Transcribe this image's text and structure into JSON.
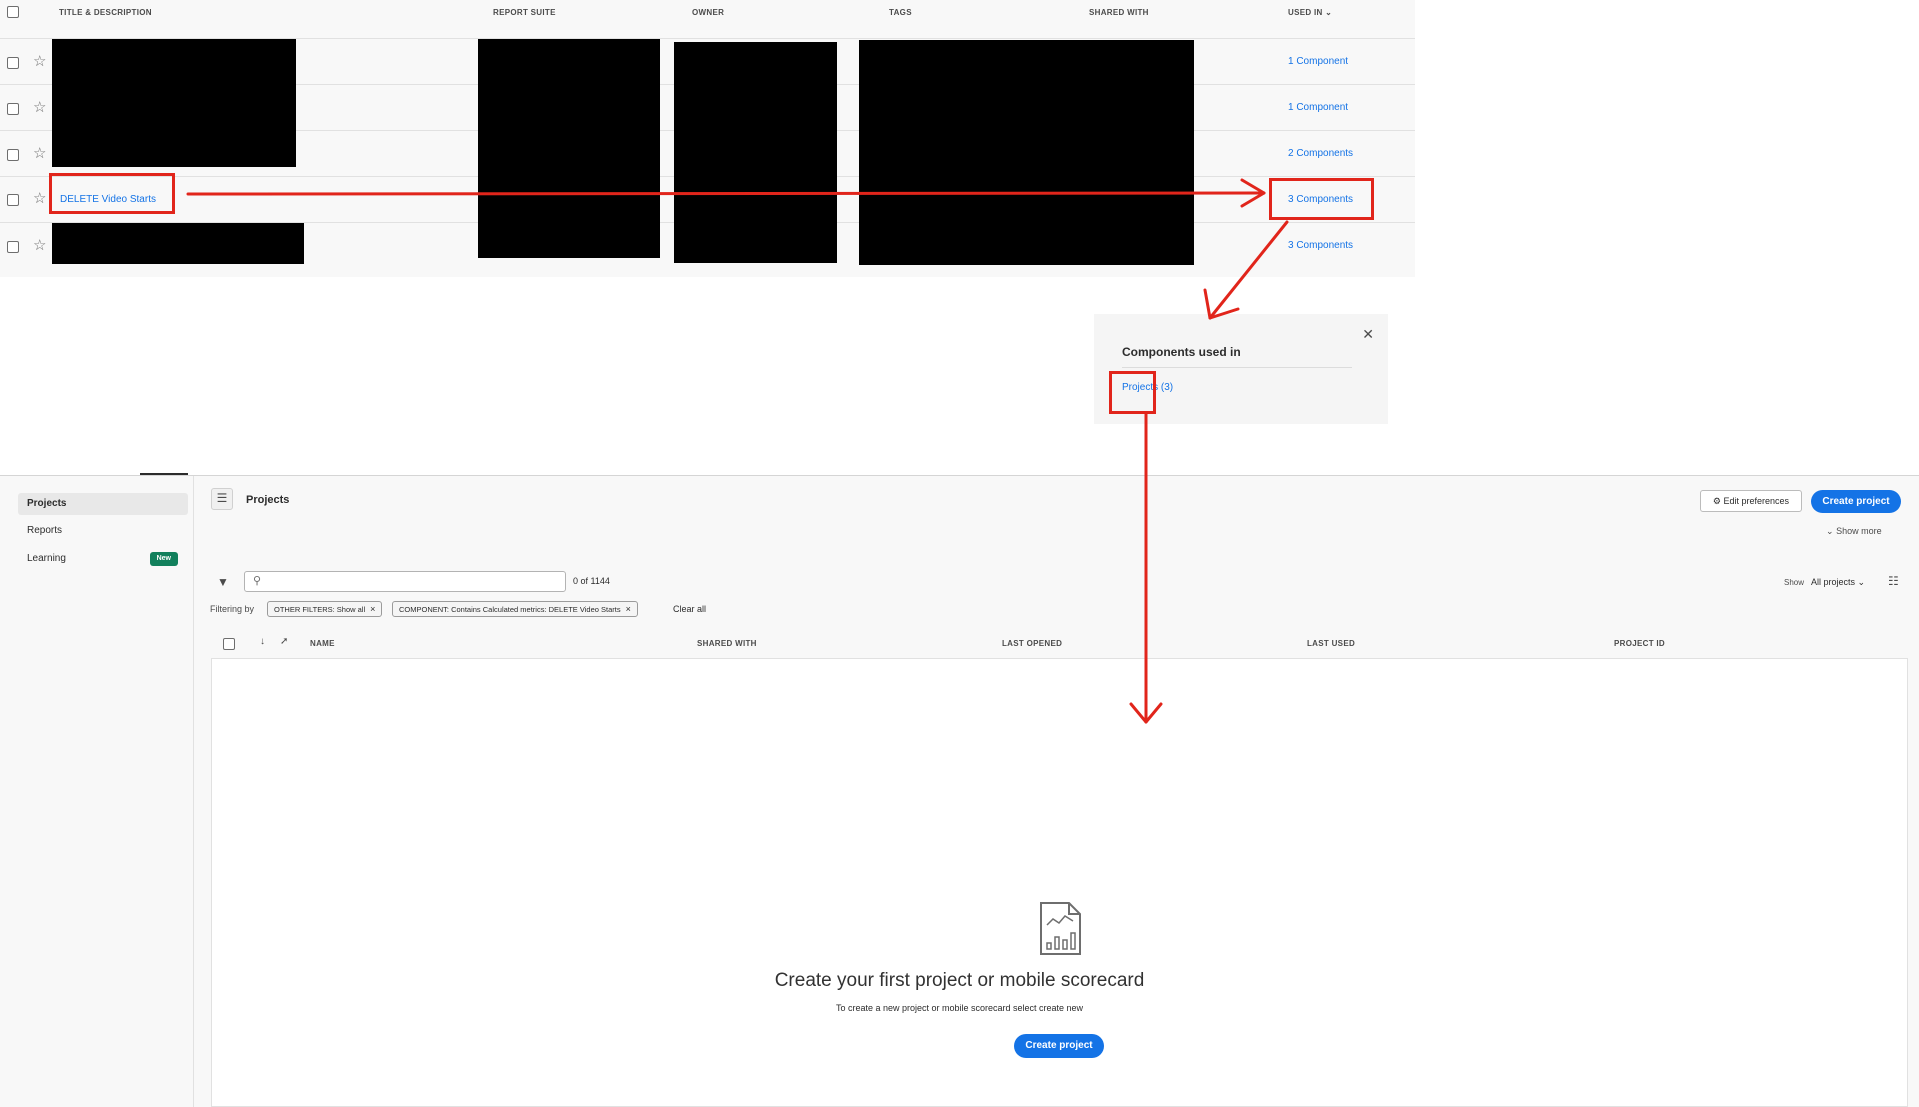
{
  "components_table": {
    "columns": [
      "TITLE & DESCRIPTION",
      "REPORT SUITE",
      "OWNER",
      "TAGS",
      "SHARED WITH",
      "USED IN"
    ],
    "rows": [
      {
        "title": "",
        "used_in": "1 Component"
      },
      {
        "title": "",
        "used_in": "1 Component"
      },
      {
        "title": "",
        "used_in": "2 Components"
      },
      {
        "title": "DELETE Video Starts",
        "used_in": "3 Components"
      },
      {
        "title": "",
        "used_in": "3 Components"
      }
    ]
  },
  "popover": {
    "title": "Components used in",
    "projects_link": "Projects (3)",
    "close_icon": "close-icon"
  },
  "sidebar": {
    "items": [
      {
        "label": "Projects",
        "active": true
      },
      {
        "label": "Reports",
        "active": false
      },
      {
        "label": "Learning",
        "active": false,
        "badge": "New"
      }
    ]
  },
  "header": {
    "title": "Projects",
    "edit_preferences": "Edit preferences",
    "create_project": "Create project",
    "show_more": "Show more"
  },
  "filters": {
    "search_placeholder": "",
    "count": "0 of 1144",
    "filtering_by": "Filtering by",
    "chips": [
      "OTHER FILTERS: Show all",
      "COMPONENT: Contains Calculated metrics: DELETE Video Starts"
    ],
    "clear_all": "Clear all",
    "show_label": "Show",
    "show_value": "All projects"
  },
  "projects_table": {
    "columns": [
      "NAME",
      "SHARED WITH",
      "LAST OPENED",
      "LAST USED",
      "PROJECT ID"
    ]
  },
  "empty_state": {
    "title": "Create your first project or mobile scorecard",
    "subtitle": "To create a new project or mobile scorecard select create new",
    "button": "Create project"
  },
  "colors": {
    "accent": "#1473e6",
    "annotation": "#e1251b",
    "badge_green": "#12805c"
  }
}
